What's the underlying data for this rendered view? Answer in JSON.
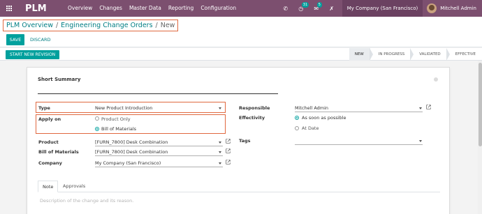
{
  "navbar": {
    "brand": "PLM",
    "menu": [
      "Overview",
      "Changes",
      "Master Data",
      "Reporting",
      "Configuration"
    ],
    "activity_count": "31",
    "message_count": "5",
    "company": "My Company (San Francisco)",
    "user": "Mitchell Admin",
    "bg_color": "#7c4f6f"
  },
  "breadcrumb": {
    "items": [
      "PLM Overview",
      "Engineering Change Orders"
    ],
    "current": "New"
  },
  "buttons": {
    "save": "SAVE",
    "discard": "DISCARD",
    "new_revision": "START NEW REVISION"
  },
  "stages": [
    "NEW",
    "IN PROGRESS",
    "VALIDATED",
    "EFFECTIVE"
  ],
  "form": {
    "short_summary_label": "Short Summary",
    "type_label": "Type",
    "type_value": "New Product Introduction",
    "apply_on_label": "Apply on",
    "apply_on_options": [
      "Product Only",
      "Bill of Materials"
    ],
    "apply_on_selected": "Bill of Materials",
    "product_label": "Product",
    "product_value": "[FURN_7800] Desk Combination",
    "bom_label": "Bill of Materials",
    "bom_value": "[FURN_7800] Desk Combination",
    "company_label": "Company",
    "company_value": "My Company (San Francisco)",
    "responsible_label": "Responsible",
    "responsible_value": "Mitchell Admin",
    "effectivity_label": "Effectivity",
    "effectivity_options": [
      "As soon as possible",
      "At Date"
    ],
    "effectivity_selected": "As soon as possible",
    "tags_label": "Tags"
  },
  "tabs": [
    "Note",
    "Approvals"
  ],
  "note_placeholder": "Description of the change and its reason.",
  "accent_color": "#00a09d",
  "highlight_color": "#e0683f"
}
